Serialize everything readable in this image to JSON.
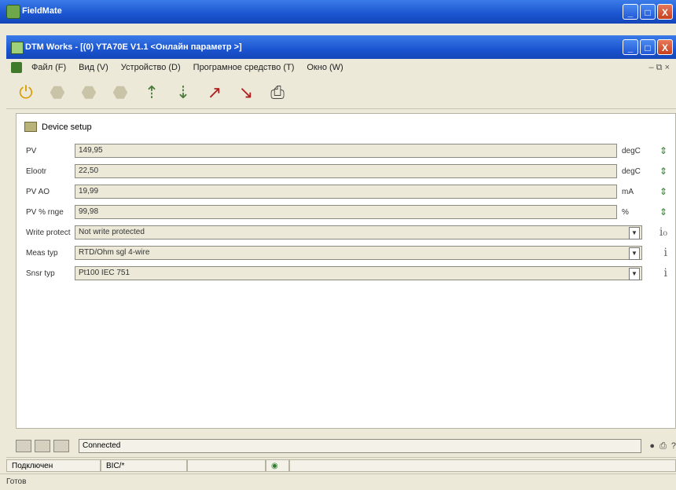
{
  "outer": {
    "title": "FieldMate"
  },
  "inner": {
    "title": "DTM Works - [(0) YTA70E V1.1 <Онлайн параметр >]"
  },
  "menu": [
    "Файл (F)",
    "Вид (V)",
    "Устройство (D)",
    "Програмное средство (T)",
    "Окно (W)"
  ],
  "window_buttons": {
    "minimize": "_",
    "maximize": "□",
    "close": "X"
  },
  "toolbar": [
    {
      "name": "online-icon",
      "glyph": "⏻",
      "tone": "gold"
    },
    {
      "name": "device-icon-1",
      "glyph": "⬣",
      "tone": "grey"
    },
    {
      "name": "device-icon-2",
      "glyph": "⬣",
      "tone": "grey"
    },
    {
      "name": "device-icon-3",
      "glyph": "⬣",
      "tone": "grey"
    },
    {
      "name": "upload-icon",
      "glyph": "⇡",
      "tone": "green"
    },
    {
      "name": "download-icon",
      "glyph": "⇣",
      "tone": "green"
    },
    {
      "name": "transfer-up-icon",
      "glyph": "↗",
      "tone": "red"
    },
    {
      "name": "transfer-down-icon",
      "glyph": "↘",
      "tone": "red"
    },
    {
      "name": "print-icon",
      "glyph": "⎙",
      "tone": "print"
    }
  ],
  "panel": {
    "breadcrumb": "Device setup",
    "rows": [
      {
        "label": "PV",
        "value": "149,95",
        "unit": "degC",
        "type": "read"
      },
      {
        "label": "Elootr",
        "value": "22,50",
        "unit": "degC",
        "type": "read"
      },
      {
        "label": "PV AO",
        "value": "19,99",
        "unit": "mA",
        "type": "read"
      },
      {
        "label": "PV % rnge",
        "value": "99,98",
        "unit": "%",
        "type": "read"
      },
      {
        "label": "Write protect",
        "value": "Not write protected",
        "type": "select",
        "info": "i₀"
      },
      {
        "label": "Meas typ",
        "value": "RTD/Ohm sgl 4-wire",
        "type": "select",
        "info": "i"
      },
      {
        "label": "Snsr typ",
        "value": "Pt100 IEC 751",
        "type": "select",
        "info": "i"
      }
    ]
  },
  "docbar": {
    "connected": "Connected"
  },
  "statusbar": {
    "status": "Подключен",
    "mode": "BIC/*"
  },
  "bottom": {
    "ready": "Готов"
  }
}
